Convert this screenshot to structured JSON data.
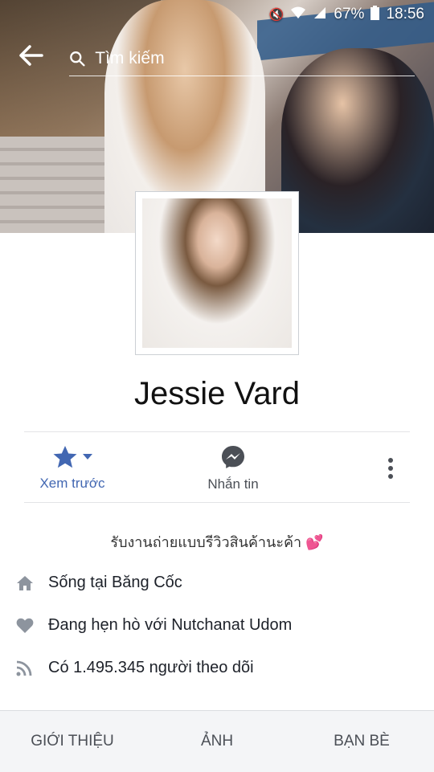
{
  "status_bar": {
    "battery": "67%",
    "time": "18:56",
    "icons": [
      "mute-icon",
      "wifi-icon",
      "signal-icon",
      "battery-icon"
    ]
  },
  "header": {
    "back_icon": "back-arrow-icon",
    "search_icon": "search-icon",
    "search_placeholder": "Tìm kiếm"
  },
  "profile": {
    "name": "Jessie Vard",
    "bio": "รับงานถ่ายแบบรีวิวสินค้านะค้า 💕"
  },
  "actions": [
    {
      "label": "Xem trước",
      "icon": "star-icon",
      "color": "#4267b2"
    },
    {
      "label": "Nhắn tin",
      "icon": "messenger-icon",
      "color": "#4b4f56"
    },
    {
      "label": "",
      "icon": "more-vertical-icon",
      "color": "#4b4f56"
    }
  ],
  "info": [
    {
      "icon": "home-icon",
      "text": "Sống tại Băng Cốc"
    },
    {
      "icon": "heart-icon",
      "text": "Đang hẹn hò với Nutchanat Udom"
    },
    {
      "icon": "rss-icon",
      "text": "Có 1.495.345 người theo dõi"
    }
  ],
  "tabs": [
    {
      "label": "GIỚI THIỆU"
    },
    {
      "label": "ẢNH"
    },
    {
      "label": "BẠN BÈ"
    }
  ],
  "colors": {
    "accent": "#4267b2",
    "text": "#1d2129",
    "muted": "#4b4f56",
    "tab_bg": "#f4f5f7"
  }
}
